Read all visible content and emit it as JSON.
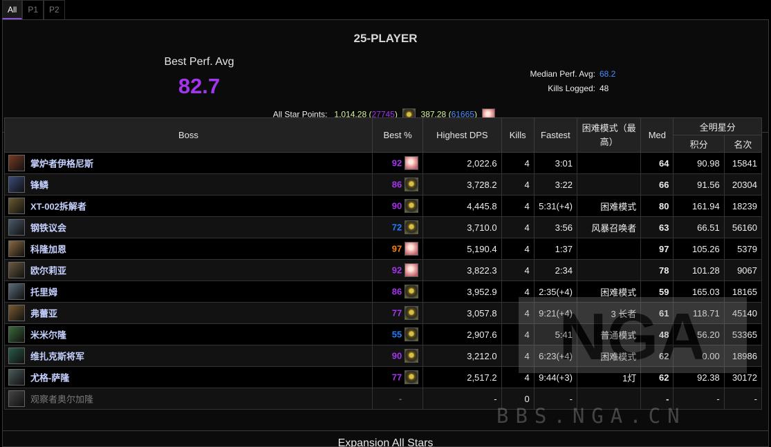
{
  "tabs": [
    {
      "label": "All",
      "active": true
    },
    {
      "label": "P1",
      "active": false
    },
    {
      "label": "P2",
      "active": false
    }
  ],
  "mode_title": "25-PLAYER",
  "best_perf": {
    "label": "Best Perf. Avg",
    "value": "82.7"
  },
  "stats": {
    "median_label": "Median Perf. Avg:",
    "median_value": "68.2",
    "kills_label": "Kills Logged:",
    "kills_value": "48"
  },
  "all_star": {
    "label": "All Star Points:",
    "p1_points": "1,014.28",
    "p1_rank": "27745",
    "p2_points": "387.28",
    "p2_rank": "61665"
  },
  "table": {
    "headers": {
      "boss": "Boss",
      "best": "Best %",
      "dps": "Highest DPS",
      "kills": "Kills",
      "fastest": "Fastest",
      "hard": "困难模式（最高）",
      "med": "Med",
      "allstars": "全明星分",
      "points": "积分",
      "rank": "名次"
    },
    "rows": [
      {
        "name": "掌炉者伊格尼斯",
        "best": "92",
        "best_color": "epic",
        "spec_icon": "pink",
        "dps": "2,022.6",
        "kills": "4",
        "fastest": "3:01",
        "hard": "",
        "med": "64",
        "med_color": "rare",
        "points": "90.98",
        "rank": "15841",
        "rank_color": "epic",
        "boss_icon_color": "#7a3a22"
      },
      {
        "name": "锋鳞",
        "best": "86",
        "best_color": "epic",
        "spec_icon": "gold",
        "dps": "3,728.2",
        "kills": "4",
        "fastest": "3:22",
        "hard": "",
        "med": "66",
        "med_color": "rare",
        "points": "91.56",
        "rank": "20304",
        "rank_color": "epic",
        "boss_icon_color": "#3a4a7a"
      },
      {
        "name": "XT-002拆解者",
        "best": "90",
        "best_color": "epic",
        "spec_icon": "gold",
        "dps": "4,445.8",
        "kills": "4",
        "fastest": "5:31(+4)",
        "hard": "困难模式",
        "med": "80",
        "med_color": "epic",
        "points": "161.94",
        "rank": "18239",
        "rank_color": "epic",
        "boss_icon_color": "#6a5a30"
      },
      {
        "name": "钢铁议会",
        "best": "72",
        "best_color": "rare",
        "spec_icon": "gold",
        "dps": "3,710.0",
        "kills": "4",
        "fastest": "3:56",
        "hard": "风暴召唤者",
        "med": "63",
        "med_color": "rare",
        "points": "66.51",
        "rank": "56160",
        "rank_color": "rare",
        "boss_icon_color": "#4a5a6a"
      },
      {
        "name": "科隆加恩",
        "best": "97",
        "best_color": "leg",
        "spec_icon": "pink",
        "dps": "5,190.4",
        "kills": "4",
        "fastest": "1:37",
        "hard": "",
        "med": "97",
        "med_color": "leg",
        "points": "105.26",
        "rank": "5379",
        "rank_color": "leg",
        "boss_icon_color": "#8a6a40"
      },
      {
        "name": "欧尔莉亚",
        "best": "92",
        "best_color": "epic",
        "spec_icon": "pink",
        "dps": "3,822.3",
        "kills": "4",
        "fastest": "2:34",
        "hard": "",
        "med": "78",
        "med_color": "epic",
        "points": "101.28",
        "rank": "9067",
        "rank_color": "epic",
        "boss_icon_color": "#6a5a40"
      },
      {
        "name": "托里姆",
        "best": "86",
        "best_color": "epic",
        "spec_icon": "gold",
        "dps": "3,952.9",
        "kills": "4",
        "fastest": "2:35(+4)",
        "hard": "困难模式",
        "med": "59",
        "med_color": "rare",
        "points": "165.03",
        "rank": "18165",
        "rank_color": "epic",
        "boss_icon_color": "#5a6a7a"
      },
      {
        "name": "弗蕾亚",
        "best": "77",
        "best_color": "epic",
        "spec_icon": "gold",
        "dps": "3,057.8",
        "kills": "4",
        "fastest": "9:21(+4)",
        "hard": "3 长者",
        "med": "61",
        "med_color": "rare",
        "points": "118.71",
        "rank": "45140",
        "rank_color": "rare",
        "boss_icon_color": "#7a5a30"
      },
      {
        "name": "米米尔隆",
        "best": "55",
        "best_color": "rare",
        "spec_icon": "gold",
        "dps": "2,907.6",
        "kills": "4",
        "fastest": "5:41",
        "hard": "普通模式",
        "med": "48",
        "med_color": "unc",
        "points": "56.20",
        "rank": "53365",
        "rank_color": "unc",
        "boss_icon_color": "#3a6a3a"
      },
      {
        "name": "维扎克斯将军",
        "best": "90",
        "best_color": "epic",
        "spec_icon": "gold",
        "dps": "3,212.0",
        "kills": "4",
        "fastest": "6:23(+4)",
        "hard": "困难模式",
        "med": "62",
        "med_color": "rare",
        "points": "0.00",
        "rank": "18986",
        "rank_color": "epic",
        "boss_icon_color": "#2a5a4a"
      },
      {
        "name": "尤格-萨隆",
        "best": "77",
        "best_color": "epic",
        "spec_icon": "gold",
        "dps": "2,517.2",
        "kills": "4",
        "fastest": "9:44(+3)",
        "hard": "1灯",
        "med": "62",
        "med_color": "rare",
        "points": "92.38",
        "rank": "30172",
        "rank_color": "rare",
        "boss_icon_color": "#4a5a5a"
      },
      {
        "name": "观察者奥尔加隆",
        "best": "-",
        "best_color": "dash",
        "spec_icon": "",
        "dps": "-",
        "kills": "0",
        "fastest": "-",
        "hard": "",
        "med": "-",
        "med_color": "dash",
        "points": "-",
        "rank": "-",
        "rank_color": "dash",
        "boss_icon_color": "#444444",
        "dim": true
      }
    ]
  },
  "watermark": {
    "logo": "NGA",
    "url": "BBS.NGA.CN"
  },
  "footer_title": "Expansion All Stars"
}
